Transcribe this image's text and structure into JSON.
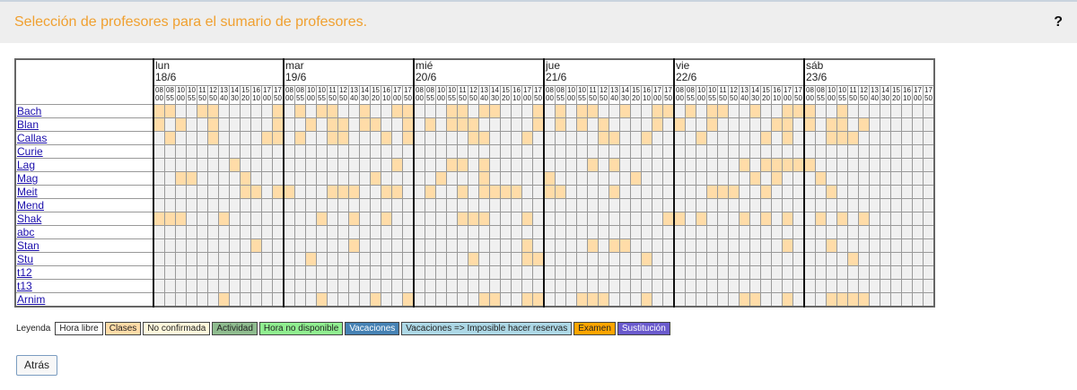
{
  "header": {
    "title": "Selección de profesores para el sumario de profesores.",
    "help": "?"
  },
  "days": [
    {
      "name": "lun",
      "date": "18/6"
    },
    {
      "name": "mar",
      "date": "19/6"
    },
    {
      "name": "mié",
      "date": "20/6"
    },
    {
      "name": "jue",
      "date": "21/6"
    },
    {
      "name": "vie",
      "date": "22/6"
    },
    {
      "name": "sáb",
      "date": "23/6"
    }
  ],
  "times": [
    "08 00",
    "08 55",
    "10 00",
    "10 55",
    "11 50",
    "12 50",
    "13 40",
    "14 30",
    "15 20",
    "16 10",
    "17 00",
    "17 50"
  ],
  "teachers": [
    {
      "name": "Bach",
      "slots": [
        [
          0,
          1,
          4,
          5,
          11
        ],
        [
          1,
          3,
          4,
          7,
          10,
          11
        ],
        [
          3,
          4,
          6,
          7,
          11
        ],
        [
          1,
          3,
          4,
          7,
          10,
          11
        ],
        [
          1,
          3,
          4,
          7,
          10,
          11
        ],
        [
          0,
          3
        ]
      ]
    },
    {
      "name": "Blan",
      "slots": [
        [
          0,
          2,
          5,
          11
        ],
        [
          2,
          4,
          5,
          7,
          8,
          11
        ],
        [
          1,
          3,
          4,
          5,
          11
        ],
        [
          1,
          3,
          5,
          10
        ],
        [
          0,
          3,
          9,
          10
        ],
        [
          0,
          2,
          3,
          5
        ]
      ]
    },
    {
      "name": "Callas",
      "slots": [
        [
          1,
          5,
          10,
          11
        ],
        [
          1,
          4,
          5,
          9,
          11
        ],
        [
          5,
          6,
          10
        ],
        [
          5,
          6,
          9
        ],
        [
          2,
          8,
          10
        ],
        [
          2,
          3,
          4
        ]
      ]
    },
    {
      "name": "Curie",
      "slots": [
        [],
        [],
        [],
        [],
        [],
        []
      ]
    },
    {
      "name": "Lag",
      "slots": [
        [
          7
        ],
        [
          10
        ],
        [
          3,
          4,
          6
        ],
        [
          4,
          6
        ],
        [
          6,
          8,
          9,
          10,
          11
        ],
        [
          0
        ]
      ]
    },
    {
      "name": "Mag",
      "slots": [
        [
          2,
          3,
          8
        ],
        [
          8
        ],
        [
          2,
          6
        ],
        [
          0,
          8
        ],
        [
          7,
          9
        ],
        [
          1
        ]
      ]
    },
    {
      "name": "Meit",
      "slots": [
        [
          8,
          9,
          11
        ],
        [
          0,
          4,
          5,
          6,
          9,
          10
        ],
        [
          1,
          4,
          6,
          7,
          8,
          9
        ],
        [
          0,
          1,
          6
        ],
        [
          3,
          4,
          5,
          8
        ],
        [
          2
        ]
      ]
    },
    {
      "name": "Mend",
      "slots": [
        [],
        [],
        [],
        [],
        [],
        []
      ]
    },
    {
      "name": "Shak",
      "slots": [
        [
          0,
          1,
          2,
          6
        ],
        [
          3,
          6,
          9
        ],
        [
          4,
          5,
          6,
          10
        ],
        [
          11
        ],
        [
          0,
          2,
          6,
          8,
          10
        ],
        [
          1,
          3,
          5
        ]
      ]
    },
    {
      "name": "abc",
      "slots": [
        [],
        [],
        [],
        [],
        [],
        []
      ]
    },
    {
      "name": "Stan",
      "slots": [
        [
          9
        ],
        [
          6
        ],
        [
          10
        ],
        [
          4,
          6,
          7
        ],
        [
          10
        ],
        [
          2
        ]
      ]
    },
    {
      "name": "Stu",
      "slots": [
        [],
        [
          2
        ],
        [
          5,
          10,
          11
        ],
        [
          9
        ],
        [],
        [
          4
        ]
      ]
    },
    {
      "name": "t12",
      "slots": [
        [],
        [],
        [],
        [],
        [],
        []
      ]
    },
    {
      "name": "t13",
      "slots": [
        [],
        [],
        [],
        [],
        [],
        []
      ]
    },
    {
      "name": "Arnim",
      "slots": [
        [
          6
        ],
        [
          3,
          8,
          11
        ],
        [
          6,
          7,
          10,
          11
        ],
        [
          3,
          4,
          5,
          9
        ],
        [
          6,
          7,
          10
        ],
        [
          2,
          3,
          4,
          5
        ]
      ]
    }
  ],
  "legend": {
    "label": "Leyenda",
    "items": [
      {
        "label": "Hora libre",
        "color": "#ffffff"
      },
      {
        "label": "Clases",
        "color": "#ffdca8"
      },
      {
        "label": "No confirmada",
        "color": "#fff8dc"
      },
      {
        "label": "Actividad",
        "color": "#8fbc8f"
      },
      {
        "label": "Hora no disponible",
        "color": "#90ee90"
      },
      {
        "label": "Vacaciones",
        "color": "#4682b4"
      },
      {
        "label": "Vacaciones => Imposible hacer reservas",
        "color": "#add8e6"
      },
      {
        "label": "Examen",
        "color": "#ffa500"
      },
      {
        "label": "Sustitución",
        "color": "#6a5acd"
      }
    ]
  },
  "back_button": "Atrás"
}
